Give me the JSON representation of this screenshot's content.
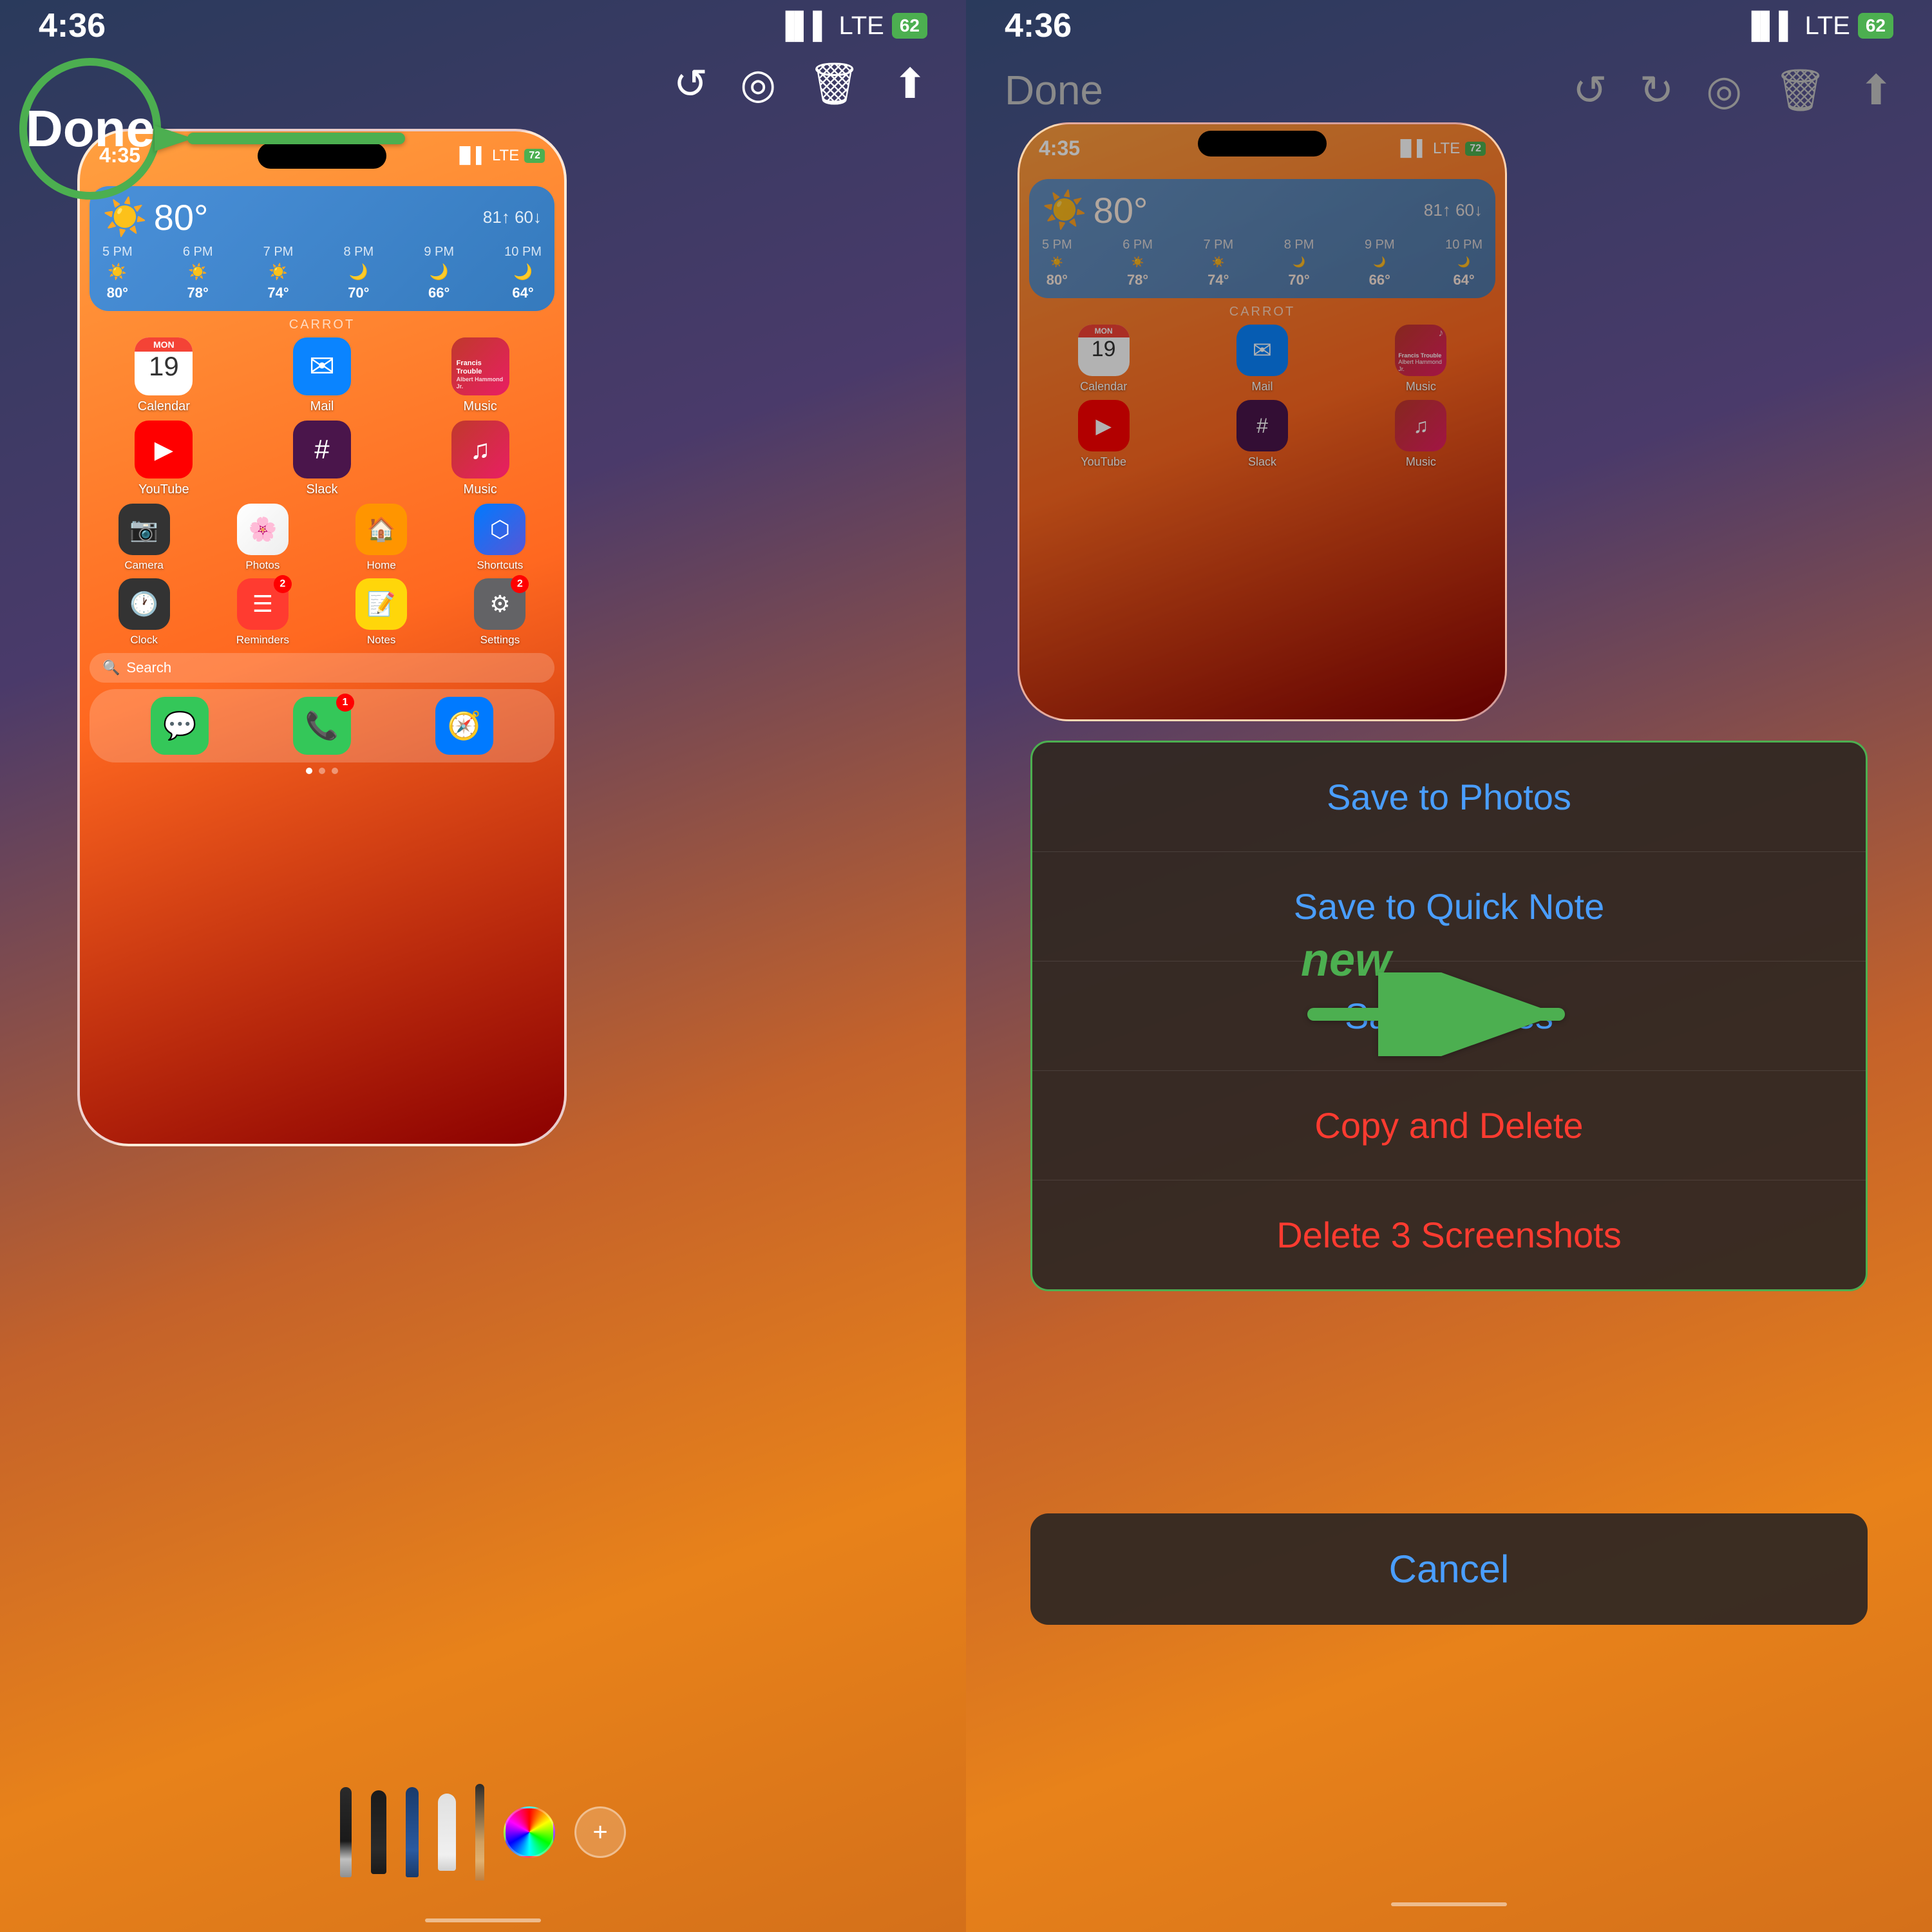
{
  "left_panel": {
    "status_bar": {
      "time": "4:36",
      "signal": "●●● LTE",
      "battery": "62"
    },
    "toolbar": {
      "done_label": "Done",
      "icons": [
        "↺",
        "◎",
        "🗑",
        "⬆"
      ]
    },
    "done_circle": {
      "label": "Done"
    },
    "phone": {
      "time": "4:35",
      "battery": "72",
      "weather": {
        "temp": "80°",
        "range": "81↑ 60↓",
        "hours": [
          {
            "time": "5 PM",
            "icon": "☀️",
            "temp": "80°"
          },
          {
            "time": "6 PM",
            "icon": "☀️",
            "temp": "78°"
          },
          {
            "time": "7 PM",
            "icon": "☀️",
            "temp": "74°"
          },
          {
            "time": "8 PM",
            "icon": "🌙",
            "temp": "70°"
          },
          {
            "time": "9 PM",
            "icon": "🌙",
            "temp": "66°"
          },
          {
            "time": "10 PM",
            "icon": "🌙",
            "temp": "64°"
          }
        ]
      },
      "carrot_label": "CARROT",
      "apps_row1": [
        {
          "name": "Calendar",
          "label": "Calendar",
          "type": "calendar",
          "date": "19",
          "day": "MON"
        },
        {
          "name": "Mail",
          "label": "Mail",
          "type": "mail"
        },
        {
          "name": "Music",
          "label": "Music",
          "type": "music",
          "song": "Francis Trouble",
          "artist": "Albert Hammond Jr."
        }
      ],
      "apps_row2": [
        {
          "name": "YouTube",
          "label": "YouTube",
          "bg": "red"
        },
        {
          "name": "Slack",
          "label": "Slack",
          "bg": "slack"
        },
        {
          "name": "Music2",
          "label": "Music",
          "type": "music2"
        }
      ],
      "apps_row3": [
        {
          "name": "Camera",
          "label": "Camera",
          "bg": "camera"
        },
        {
          "name": "Photos",
          "label": "Photos",
          "bg": "photos"
        },
        {
          "name": "Home",
          "label": "Home",
          "bg": "home"
        },
        {
          "name": "Shortcuts",
          "label": "Shortcuts",
          "bg": "shortcuts"
        }
      ],
      "apps_row4": [
        {
          "name": "Clock",
          "label": "Clock",
          "bg": "clock"
        },
        {
          "name": "Reminders",
          "label": "Reminders",
          "bg": "red",
          "badge": "2"
        },
        {
          "name": "Notes",
          "label": "Notes",
          "bg": "notes"
        },
        {
          "name": "Settings",
          "label": "Settings",
          "bg": "gray",
          "badge": "2"
        }
      ],
      "search_placeholder": "🔍 Search",
      "dock": [
        {
          "name": "Messages",
          "bg": "green"
        },
        {
          "name": "Phone",
          "bg": "green",
          "badge": "1"
        },
        {
          "name": "Safari",
          "bg": "blue"
        }
      ]
    },
    "drawing_tools": {
      "tools": [
        "pen",
        "marker",
        "blue-marker",
        "eraser",
        "pencil"
      ],
      "color_wheel": true,
      "add_button": "+"
    }
  },
  "right_panel": {
    "status_bar": {
      "time": "4:36",
      "signal": "●●● LTE",
      "battery": "62"
    },
    "toolbar": {
      "done_label": "Done"
    },
    "new_label": "new",
    "context_menu": {
      "items": [
        {
          "label": "Save to Photos",
          "color": "blue",
          "id": "save-photos"
        },
        {
          "label": "Save to Quick Note",
          "color": "blue",
          "id": "save-quick-note"
        },
        {
          "label": "Save to Files",
          "color": "blue",
          "id": "save-files"
        },
        {
          "label": "Copy and Delete",
          "color": "red",
          "id": "copy-delete"
        },
        {
          "label": "Delete 3 Screenshots",
          "color": "red",
          "id": "delete-screenshots"
        }
      ]
    },
    "cancel_button": {
      "label": "Cancel"
    }
  }
}
